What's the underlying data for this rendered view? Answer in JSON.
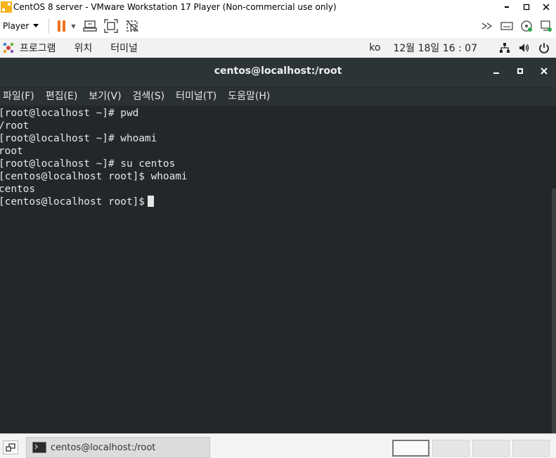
{
  "vmware": {
    "title": "CentOS 8 server - VMware Workstation 17 Player (Non-commercial use only)",
    "player_label": "Player",
    "icons": [
      "pause-icon",
      "send-ctrl-alt-del-icon",
      "fit-guest-icon",
      "unity-icon",
      "forward-icon",
      "removable-devices-icon",
      "cd-icon",
      "network-adapter-icon"
    ],
    "window_controls": {
      "minimize": "▪",
      "maximize": "□",
      "close": "✕"
    }
  },
  "gnome": {
    "menu": [
      "프로그램",
      "위치",
      "터미널"
    ],
    "lang": "ko",
    "clock": "12월 18일  16 : 07",
    "tray_icons": [
      "network-icon",
      "volume-icon",
      "power-icon"
    ]
  },
  "terminal": {
    "title": "centos@localhost:/root",
    "controls": {
      "minimize": "–",
      "maximize": "▪",
      "close": "✕"
    },
    "menus": [
      "파일(F)",
      "편집(E)",
      "보기(V)",
      "검색(S)",
      "터미널(T)",
      "도움말(H)"
    ],
    "lines": [
      "[root@localhost ~]# pwd",
      "/root",
      "[root@localhost ~]# whoami",
      "root",
      "[root@localhost ~]# su centos",
      "[centos@localhost root]$ whoami",
      "centos",
      "[centos@localhost root]$"
    ],
    "background": "#232729",
    "foreground": "#e6e6e6"
  },
  "taskbar": {
    "task_label": "centos@localhost:/root",
    "workspaces": 4,
    "active_workspace": 1
  }
}
